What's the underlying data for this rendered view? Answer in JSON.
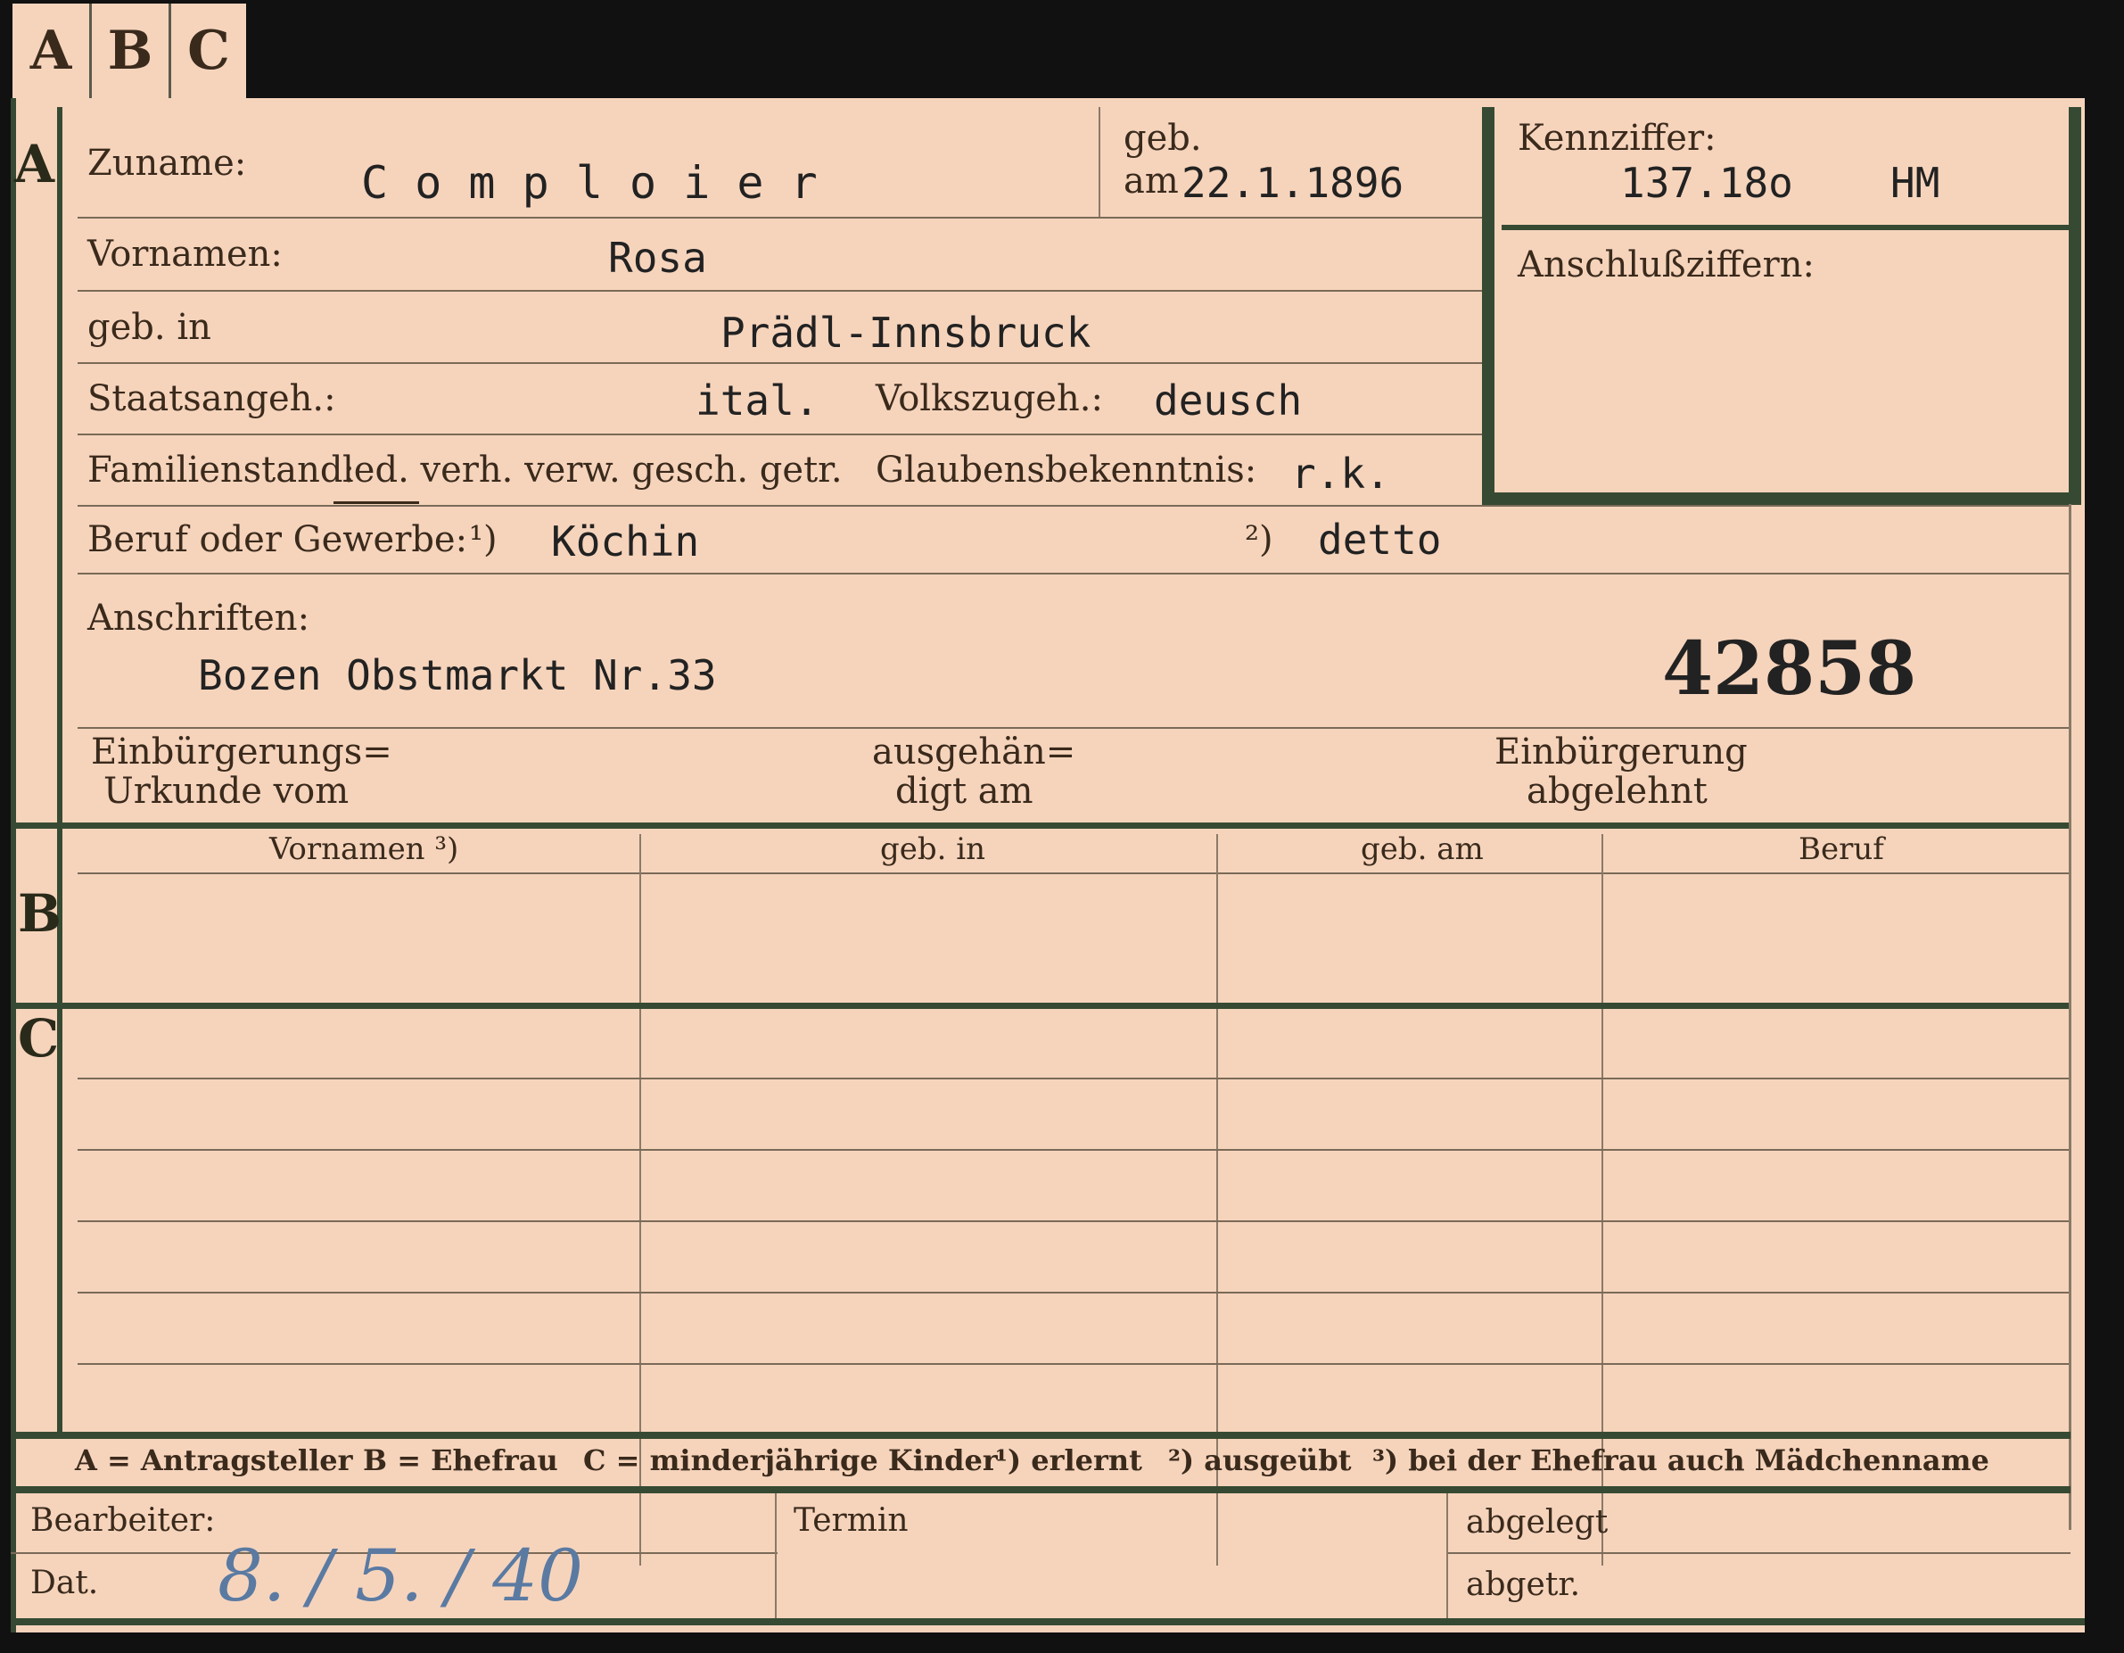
{
  "tabs": [
    "A",
    "B",
    "C"
  ],
  "section_a": {
    "marker": "A",
    "surname_label": "Zuname:",
    "surname": "C o m p l o i e r",
    "born_label_top": "geb.",
    "born_label_bottom": "am",
    "born_date": "22.1.1896",
    "kennziffer_label": "Kennziffer:",
    "kennziffer": "137.18o",
    "kennziffer_suffix": "HM",
    "anschluss_label": "Anschlußziffern:",
    "firstname_label": "Vornamen:",
    "firstname": "Rosa",
    "birthplace_label": "geb. in",
    "birthplace": "Prädl-Innsbruck",
    "citizenship_label": "Staatsangeh.:",
    "citizenship": "ital.",
    "ethnicity_label": "Volkszugeh.:",
    "ethnicity": "deusch",
    "family_status_label": "Familienstand:",
    "family_status_options": "led. verh. verw. gesch. getr.",
    "religion_label": "Glaubensbekenntnis:",
    "religion": "r.k.",
    "occupation_label": "Beruf oder Gewerbe:",
    "occ_mark1": "¹)",
    "occupation_learned": "Köchin",
    "occ_mark2": "²)",
    "occupation_practiced": "detto",
    "address_label": "Anschriften:",
    "address": "Bozen Obstmarkt Nr.33",
    "record_number": "42858",
    "naturalization_label_1": "Einbürgerungs=",
    "naturalization_label_2": "Urkunde vom",
    "handed_label_1": "ausgehän=",
    "handed_label_2": "digt am",
    "rejected_label_1": "Einbürgerung",
    "rejected_label_2": "abgelehnt"
  },
  "section_b": {
    "marker": "B",
    "columns": [
      "Vornamen ³)",
      "geb. in",
      "geb. am",
      "Beruf"
    ]
  },
  "section_c": {
    "marker": "C"
  },
  "legend": {
    "a": "A = Antragsteller",
    "b": "B = Ehefrau",
    "c": "C = minderjährige Kinder",
    "n1": "¹) erlernt",
    "n2": "²) ausgeübt",
    "n3": "³) bei der Ehefrau auch Mädchenname"
  },
  "footer": {
    "editor_label": "Bearbeiter:",
    "date_label": "Dat.",
    "date_value": "8. / 5. / 40",
    "deadline_label": "Termin",
    "filed_label": "abgelegt",
    "removed_label": "abgetr."
  }
}
